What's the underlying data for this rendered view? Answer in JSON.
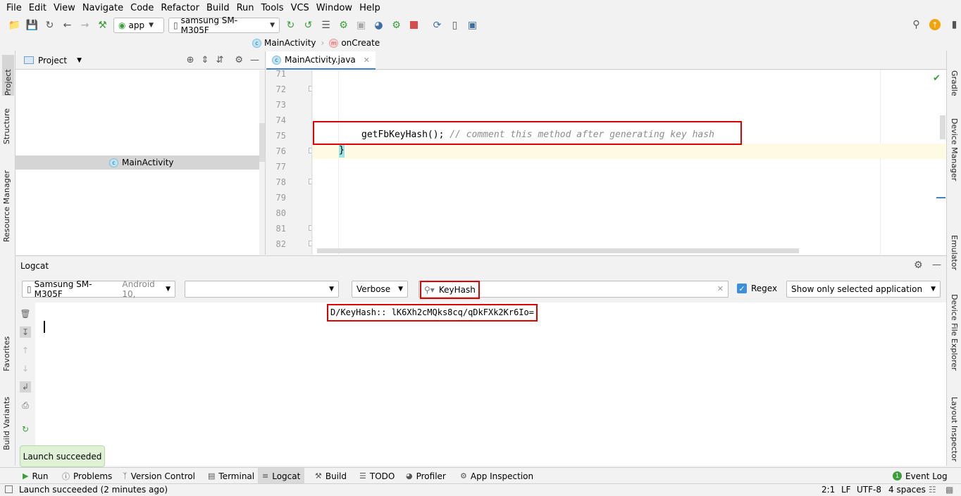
{
  "menu": [
    "File",
    "Edit",
    "View",
    "Navigate",
    "Code",
    "Refactor",
    "Build",
    "Run",
    "Tools",
    "VCS",
    "Window",
    "Help"
  ],
  "toolbar": {
    "config": "app",
    "device": "samsung SM-M305F"
  },
  "breadcrumb": {
    "class": "MainActivity",
    "method": "onCreate"
  },
  "left_tabs": {
    "project": "Project",
    "structure": "Structure",
    "resource_manager": "Resource Manager",
    "favorites": "Favorites",
    "build_variants": "Build Variants"
  },
  "right_tabs": {
    "gradle": "Gradle",
    "device_manager": "Device Manager",
    "emulator": "Emulator",
    "device_file_explorer": "Device File Explorer",
    "layout_inspector": "Layout Inspector"
  },
  "project_panel": {
    "title": "Project",
    "selected_item": "MainActivity"
  },
  "editor": {
    "tab": "MainActivity.java",
    "line_numbers": [
      "71",
      "72",
      "73",
      "74",
      "75",
      "76",
      "77",
      "78",
      "79",
      "80",
      "81",
      "82"
    ],
    "code_call": "getFbKeyHash();",
    "code_comment": "// comment this method after generating key hash",
    "brace": "}"
  },
  "logcat": {
    "title": "Logcat",
    "device": "Samsung SM-M305F",
    "device_detail": "Android 10,",
    "process": "",
    "level": "Verbose",
    "search": "KeyHash",
    "regex_label": "Regex",
    "filter": "Show only selected application",
    "log_line": "D/KeyHash:: lK6Xh2cMQks8cq/qDkFXk2Kr6Io="
  },
  "toast": "Launch succeeded",
  "bottom_tabs": {
    "run": "Run",
    "problems": "Problems",
    "version_control": "Version Control",
    "terminal": "Terminal",
    "logcat": "Logcat",
    "build": "Build",
    "todo": "TODO",
    "profiler": "Profiler",
    "app_inspection": "App Inspection",
    "event_log": "Event Log"
  },
  "status": {
    "message": "Launch succeeded (2 minutes ago)",
    "position": "2:1",
    "line_sep": "LF",
    "encoding": "UTF-8",
    "indent": "4 spaces"
  },
  "colors": {
    "highlight_box": "#e00000",
    "accent": "#3d8fd9"
  }
}
